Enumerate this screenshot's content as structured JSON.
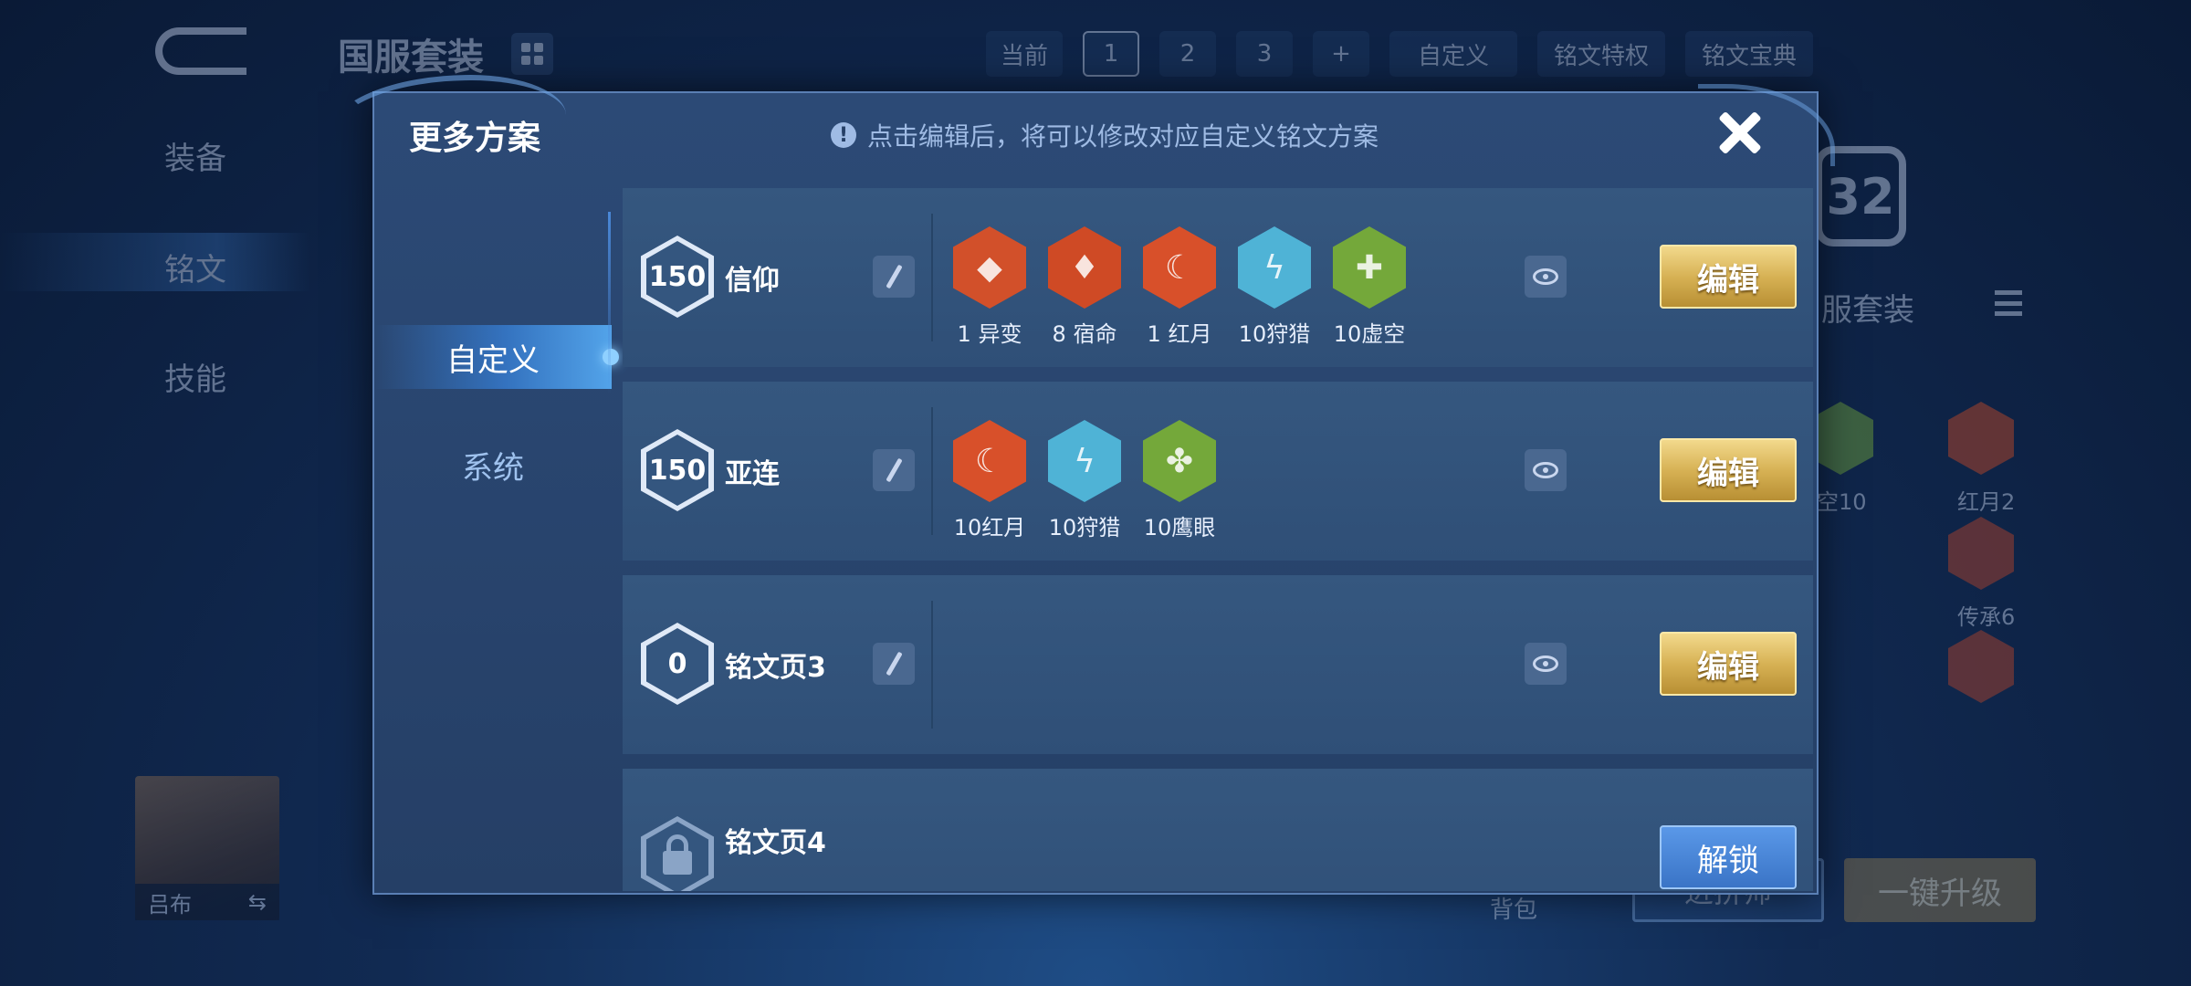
{
  "background": {
    "title": "国服套装",
    "topbar": {
      "current_label": "当前",
      "pages": [
        "1",
        "2",
        "3"
      ],
      "add_label": "+",
      "custom_label": "自定义",
      "privilege_label": "铭文特权",
      "codex_label": "铭文宝典"
    },
    "sidebar": [
      "装备",
      "铭文",
      "技能"
    ],
    "rune_count": "32",
    "set_label": "服套装",
    "rune_labels": [
      "空10",
      "红月2",
      "传承6"
    ],
    "hero_name": "吕布",
    "bag_label": "背包",
    "button_left": "进拼师",
    "button_upgrade": "一键升级"
  },
  "modal": {
    "title": "更多方案",
    "hint": "点击编辑后，将可以修改对应自定义铭文方案",
    "hint_icon": "!",
    "tabs": [
      {
        "label": "自定义",
        "active": true
      },
      {
        "label": "系统",
        "active": false
      }
    ],
    "edit_label": "编辑",
    "unlock_label": "解锁",
    "rows": [
      {
        "level": "150",
        "name": "信仰",
        "runes": [
          {
            "label": "1 异变",
            "color": "#d2502a",
            "icon": "rune-red-icon"
          },
          {
            "label": "8 宿命",
            "color": "#cf4a25",
            "icon": "rune-red-icon"
          },
          {
            "label": "1 红月",
            "color": "#d8502a",
            "icon": "rune-red-icon"
          },
          {
            "label": "10狩猎",
            "color": "#4fb3d6",
            "icon": "rune-blue-icon"
          },
          {
            "label": "10虚空",
            "color": "#74a83a",
            "icon": "rune-green-icon"
          }
        ]
      },
      {
        "level": "150",
        "name": "亚连",
        "runes": [
          {
            "label": "10红月",
            "color": "#d8502a",
            "icon": "rune-red-icon"
          },
          {
            "label": "10狩猎",
            "color": "#4fb3d6",
            "icon": "rune-blue-icon"
          },
          {
            "label": "10鹰眼",
            "color": "#74a83a",
            "icon": "rune-green-icon"
          }
        ]
      },
      {
        "level": "0",
        "name": "铭文页3",
        "runes": []
      },
      {
        "level": "",
        "name": "铭文页4",
        "locked": true,
        "runes": []
      }
    ]
  }
}
